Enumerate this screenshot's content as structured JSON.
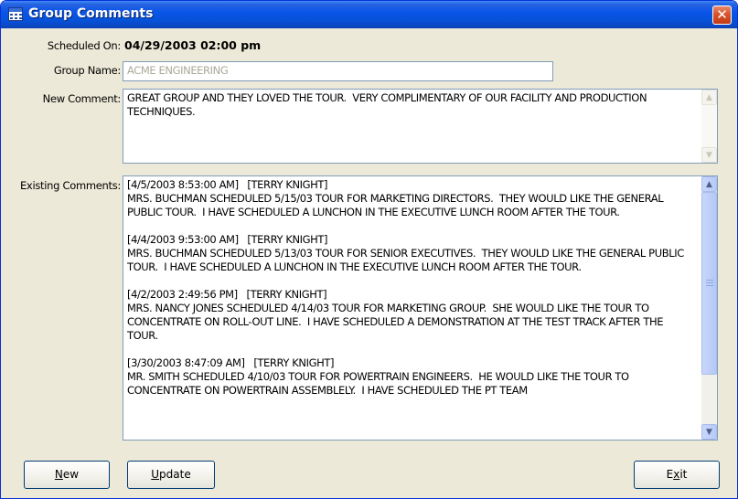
{
  "window": {
    "title": "Group Comments",
    "close_glyph": "✕"
  },
  "icons": {
    "window_icon": "calendar-grid-icon",
    "close": "close-icon"
  },
  "fields": {
    "scheduled_on_label": "Scheduled On:",
    "scheduled_on_value": "04/29/2003 02:00 pm",
    "group_name_label": "Group Name:",
    "group_name_value": "ACME ENGINEERING",
    "new_comment_label": "New Comment:",
    "new_comment_value": "GREAT GROUP AND THEY LOVED THE TOUR.  VERY COMPLIMENTARY OF OUR FACILITY AND PRODUCTION TECHNIQUES.",
    "existing_comments_label": "Existing Comments:",
    "existing_comments_value": "[4/5/2003 8:53:00 AM]   [TERRY KNIGHT]\nMRS. BUCHMAN SCHEDULED 5/15/03 TOUR FOR MARKETING DIRECTORS.  THEY WOULD LIKE THE GENERAL PUBLIC TOUR.  I HAVE SCHEDULED A LUNCHON IN THE EXECUTIVE LUNCH ROOM AFTER THE TOUR.\n\n[4/4/2003 9:53:00 AM]   [TERRY KNIGHT]\nMRS. BUCHMAN SCHEDULED 5/13/03 TOUR FOR SENIOR EXECUTIVES.  THEY WOULD LIKE THE GENERAL PUBLIC TOUR.  I HAVE SCHEDULED A LUNCHON IN THE EXECUTIVE LUNCH ROOM AFTER THE TOUR.\n\n[4/2/2003 2:49:56 PM]   [TERRY KNIGHT]\nMRS. NANCY JONES SCHEDULED 4/14/03 TOUR FOR MARKETING GROUP.  SHE WOULD LIKE THE TOUR TO CONCENTRATE ON ROLL-OUT LINE.  I HAVE SCHEDULED A DEMONSTRATION AT THE TEST TRACK AFTER THE TOUR.\n\n[3/30/2003 8:47:09 AM]   [TERRY KNIGHT]\nMR. SMITH SCHEDULED 4/10/03 TOUR FOR POWERTRAIN ENGINEERS.  HE WOULD LIKE THE TOUR TO CONCENTRATE ON POWERTRAIN ASSEMBLELY.  I HAVE SCHEDULED THE PT TEAM"
  },
  "buttons": {
    "new_pre": "",
    "new_key": "N",
    "new_post": "ew",
    "update_pre": "",
    "update_key": "U",
    "update_post": "pdate",
    "exit_pre": "E",
    "exit_key": "x",
    "exit_post": "it"
  },
  "colors": {
    "title_bar": "#0a55e8",
    "dialog_bg": "#ece9d8",
    "close_button": "#d9532b",
    "textbox_border": "#7f9db9",
    "disabled_text": "#aca899"
  }
}
